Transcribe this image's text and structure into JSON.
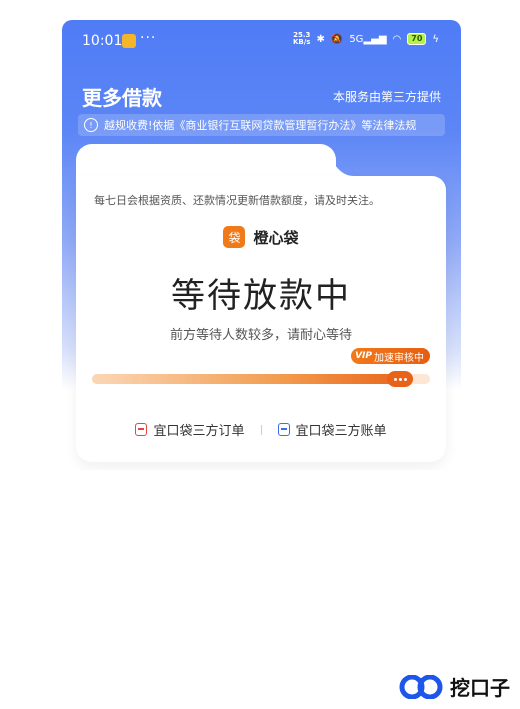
{
  "status_bar": {
    "time": "10:01",
    "net_speed_value": "25.3",
    "net_speed_unit": "KB/s",
    "network": "5G",
    "battery": "70"
  },
  "header": {
    "title": "更多借款",
    "provider_note": "本服务由第三方提供"
  },
  "notice": {
    "text": "越规收费!依据《商业银行互联网贷款管理暂行办法》等法律法规"
  },
  "card": {
    "update_note": "每七日会根据资质、还款情况更新借款额度，请及时关注。",
    "brand_name": "橙心袋",
    "brand_logo_char": "袋",
    "status_title": "等待放款中",
    "sub_text": "前方等待人数较多，请耐心等待",
    "speed_badge_vip": "VIP",
    "speed_badge_label": "加速审核中",
    "progress_fraction": 0.95,
    "links": {
      "orders": "宜口袋三方订单",
      "bills": "宜口袋三方账单"
    }
  },
  "watermark": {
    "text": "挖口子"
  },
  "colors": {
    "header_blue": "#4f7cf6",
    "accent_orange": "#f07a1a",
    "orders_icon": "#e8453c",
    "bills_icon": "#3d6cf2"
  }
}
